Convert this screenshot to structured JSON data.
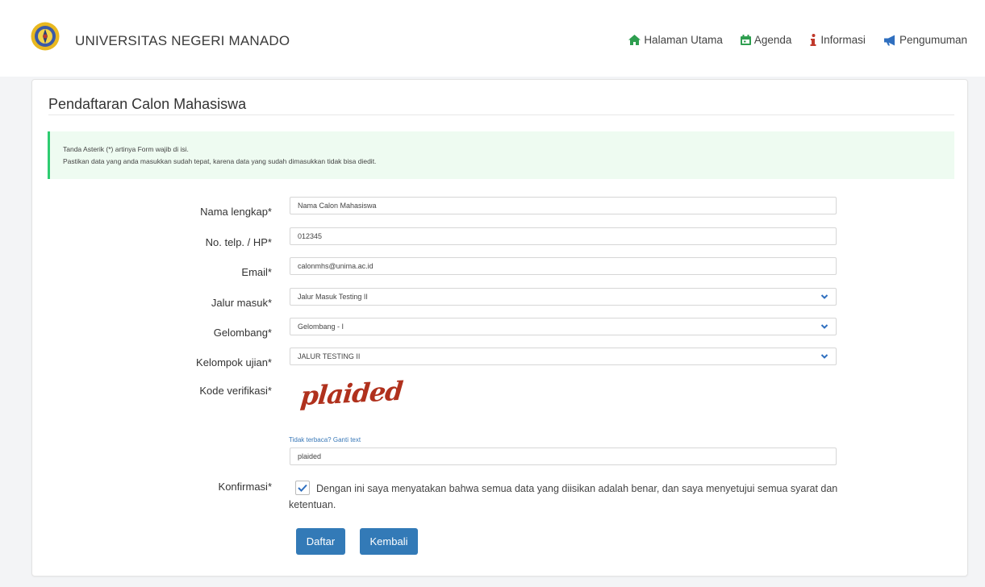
{
  "header": {
    "brand": "UNIVERSITAS NEGERI MANADO",
    "nav": [
      {
        "label": "Halaman Utama",
        "icon": "home-icon",
        "color": "#2e9e4f"
      },
      {
        "label": "Agenda",
        "icon": "calendar-icon",
        "color": "#2e9e4f"
      },
      {
        "label": "Informasi",
        "icon": "info-icon",
        "color": "#c0392b"
      },
      {
        "label": "Pengumuman",
        "icon": "megaphone-icon",
        "color": "#2f6fbf"
      }
    ]
  },
  "page": {
    "title": "Pendaftaran Calon Mahasiswa",
    "alert": {
      "line1": "Tanda Asterik (*) artinya Form wajib di isi.",
      "line2": "Pastikan data yang anda masukkan sudah tepat, karena data yang sudah dimasukkan tidak bisa diedit."
    }
  },
  "form": {
    "nama": {
      "label": "Nama lengkap*",
      "value": "Nama Calon Mahasiswa"
    },
    "telp": {
      "label": "No. telp. / HP*",
      "value": "012345"
    },
    "email": {
      "label": "Email*",
      "value": "calonmhs@unima.ac.id"
    },
    "jalur": {
      "label": "Jalur masuk*",
      "value": "Jalur Masuk Testing II"
    },
    "gelombang": {
      "label": "Gelombang*",
      "value": "Gelombang - I"
    },
    "kelompok": {
      "label": "Kelompok ujian*",
      "value": "JALUR TESTING II"
    },
    "kode": {
      "label": "Kode verifikasi*",
      "captcha_text": "plaided",
      "refresh_link": "Tidak terbaca? Ganti text",
      "value": "plaided"
    },
    "konfirmasi": {
      "label": "Konfirmasi*",
      "checked": true,
      "text": "Dengan ini saya menyatakan bahwa semua data yang diisikan adalah benar, dan saya menyetujui semua syarat dan ketentuan."
    }
  },
  "buttons": {
    "daftar": "Daftar",
    "kembali": "Kembali"
  },
  "colors": {
    "primary": "#337ab7",
    "alert_border": "#2ecc71",
    "alert_bg": "#eefbf1",
    "captcha": "#b0311d"
  }
}
